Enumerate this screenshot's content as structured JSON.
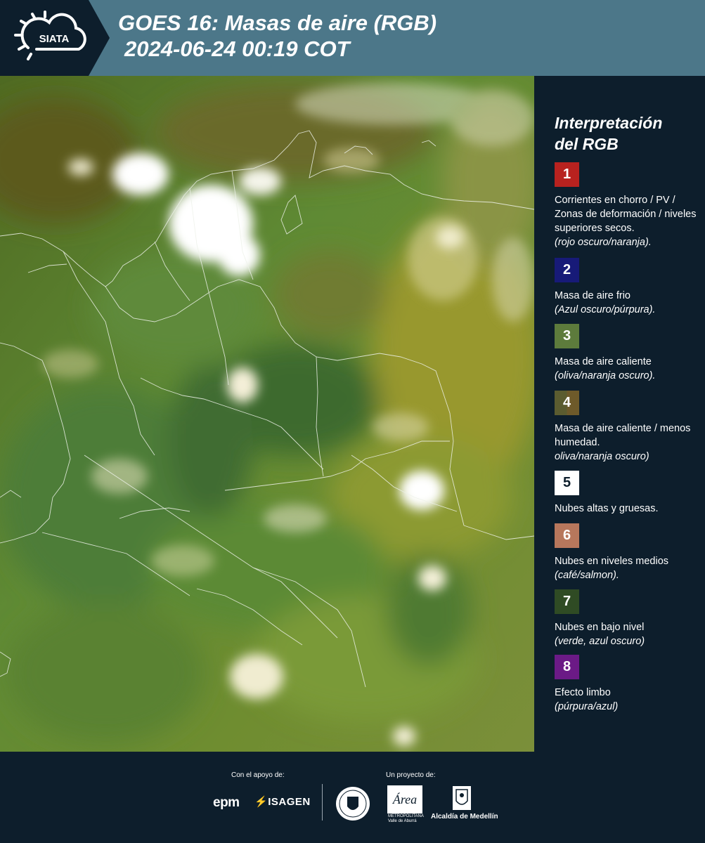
{
  "header": {
    "logo_text": "SIATA",
    "title_line1": "GOES 16: Masas de aire (RGB)",
    "title_line2": "2024-06-24 00:19 COT",
    "background_color": "#4c7789"
  },
  "map": {
    "description_icon": "satellite-rgb-air-mass-image"
  },
  "legend": {
    "title_line1": "Interpretación",
    "title_line2": "del RGB",
    "items": [
      {
        "number": "1",
        "color": "#b8221f",
        "label": "Corrientes en chorro / PV / Zonas de deformación / niveles superiores secos.",
        "note": "(rojo oscuro/naranja)."
      },
      {
        "number": "2",
        "color": "#171a78",
        "label": "Masa de aire frio",
        "note": "(Azul oscuro/púrpura)."
      },
      {
        "number": "3",
        "color": "#5d7b3c",
        "label": "Masa de aire caliente",
        "note": "(oliva/naranja oscuro)."
      },
      {
        "number": "4",
        "color": "#6e5a2a",
        "color2": "#5b5c30",
        "label": "Masa de aire caliente / menos humedad.",
        "note": "oliva/naranja oscuro)"
      },
      {
        "number": "5",
        "color": "#ffffff",
        "label": "Nubes altas y gruesas.",
        "note": ""
      },
      {
        "number": "6",
        "color": "#b7775c",
        "label": "Nubes en niveles medios",
        "note": "(café/salmon)."
      },
      {
        "number": "7",
        "color": "#2f4b24",
        "label": "Nubes en bajo nivel",
        "note": "(verde, azul oscuro)"
      },
      {
        "number": "8",
        "color": "#6b1a86",
        "label": "Efecto limbo",
        "note": "(púrpura/azul)"
      }
    ]
  },
  "footer": {
    "support_label": "Con el apoyo de:",
    "project_label": "Un proyecto de:",
    "sponsor1": "epm",
    "sponsor2": "ISAGEN",
    "partner_amva_line1": "METROPOLITANA",
    "partner_amva_line2": "Valle de Aburrá",
    "partner_alcaldia": "Alcaldía de Medellín"
  }
}
